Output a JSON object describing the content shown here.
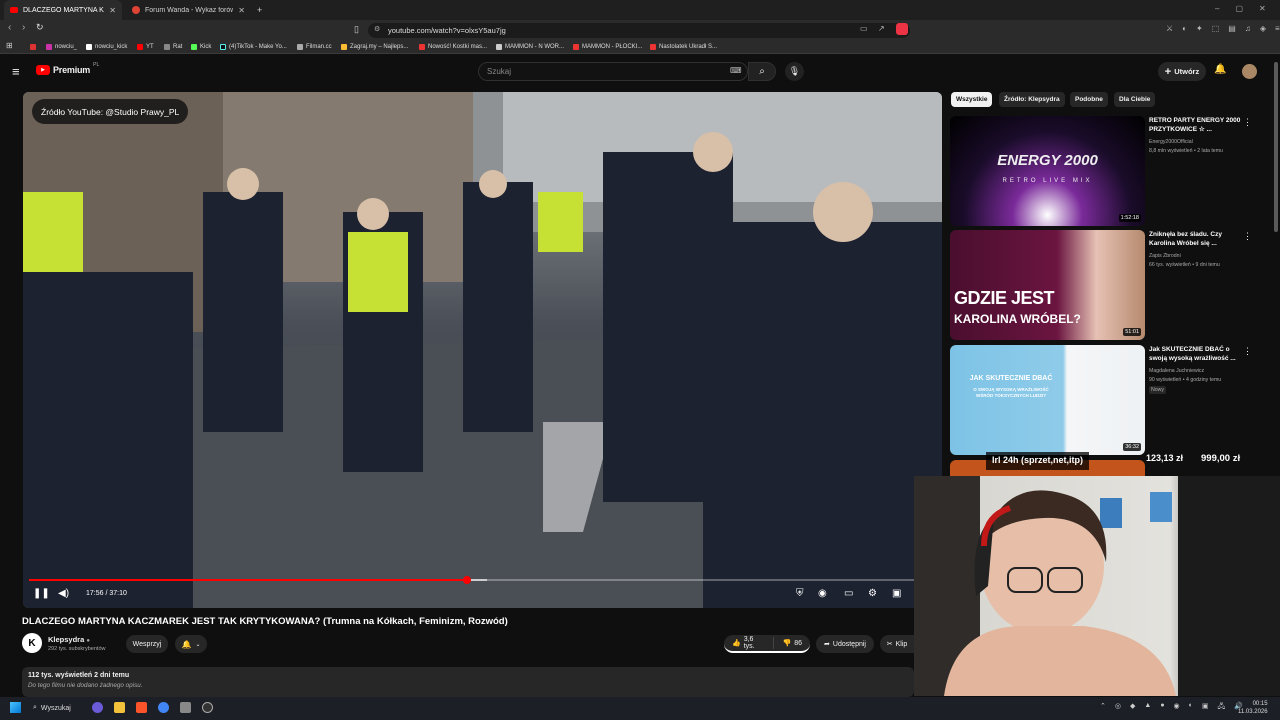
{
  "browser": {
    "tabs": [
      {
        "title": "DLACZEGO MARTYNA KACZ...",
        "active": true
      },
      {
        "title": "Forum Wanda - Wykaz forów",
        "active": false
      }
    ],
    "new_tab": "+",
    "url": "youtube.com/watch?v=olxsY5au7jg",
    "bookmarks": [
      "nowciu_",
      "nowciu_kick",
      "YT",
      "Rat",
      "Kick",
      "(4)TikTok - Make Yo...",
      "Filman.cc",
      "Zagraj.my – Najleps...",
      "Nowość! Kostki mas...",
      "MAMMON - N WOR...",
      "MAMMON - PŁOCKI...",
      "Nastolatek Ukradł S..."
    ]
  },
  "youtube": {
    "logo_text": "Premium",
    "logo_region": "PL",
    "search_placeholder": "Szukaj",
    "create_label": "Utwórz"
  },
  "video": {
    "source_badge": "Źródło YouTube: @Studio Prawy_PL",
    "current_time": "17:56 / 37:10",
    "progress_fraction": 0.483,
    "title": "DLACZEGO MARTYNA KACZMAREK JEST TAK KRYTYKOWANA? (Trumna na Kółkach, Feminizm, Rozwód)",
    "channel": {
      "name": "Klepsydra",
      "initial": "K",
      "subscribers": "292 tys. subskrybentów",
      "support_label": "Wesprzyj"
    },
    "likes": "3,6 tys.",
    "dislikes": "86",
    "share_label": "Udostępnij",
    "clip_label": "Klip",
    "views_date": "112 tys. wyświetleń  2 dni temu",
    "description": "Do tego filmu nie dodano żadnego opisu."
  },
  "sidebar": {
    "chips": [
      {
        "label": "Wszystkie",
        "active": true
      },
      {
        "label": "Źródło: Klepsydra",
        "active": false
      },
      {
        "label": "Podobne",
        "active": false
      },
      {
        "label": "Dla Ciebie",
        "active": false
      }
    ],
    "recommendations": [
      {
        "title": "RETRO PARTY ENERGY 2000 PRZYTKOWICE ☆ ...",
        "channel": "Energy2000Official",
        "meta": "8,8 mln wyświetleń • 2 lata temu",
        "duration": "1:52:18",
        "thumb_text1": "ENERGY 2000",
        "thumb_text2": "RETRO LIVE MIX",
        "badge": ""
      },
      {
        "title": "Zniknęła bez śladu. Czy Karolina Wróbel się ...",
        "channel": "Zapis Zbrodni",
        "meta": "66 tys. wyświetleń • 9 dni temu",
        "duration": "51:01",
        "thumb_text1": "GDZIE JEST",
        "thumb_text2": "KAROLINA WRÓBEL?",
        "badge": ""
      },
      {
        "title": "Jak SKUTECZNIE DBAĆ o swoją wysoką wrażliwość ...",
        "channel": "Magdalena Juchniewicz",
        "meta": "90 wyświetleń • 4 godziny temu",
        "duration": "36:32",
        "thumb_text1": "JAK SKUTECZNIE DBAĆ",
        "thumb_text2": "O SWOJĄ WYSOKĄ WRAŻLIWOŚĆ WŚRÓD TOKSYCZNYCH LUDZI?",
        "badge": "Nowy"
      }
    ]
  },
  "overlay": {
    "text": "Irl 24h (sprzet,net,itp)",
    "amount1": "123,13 zł",
    "amount2": "999,00 zł"
  },
  "taskbar": {
    "search_label": "Wyszukaj",
    "time": "00:15",
    "date": "11.03.2026"
  }
}
